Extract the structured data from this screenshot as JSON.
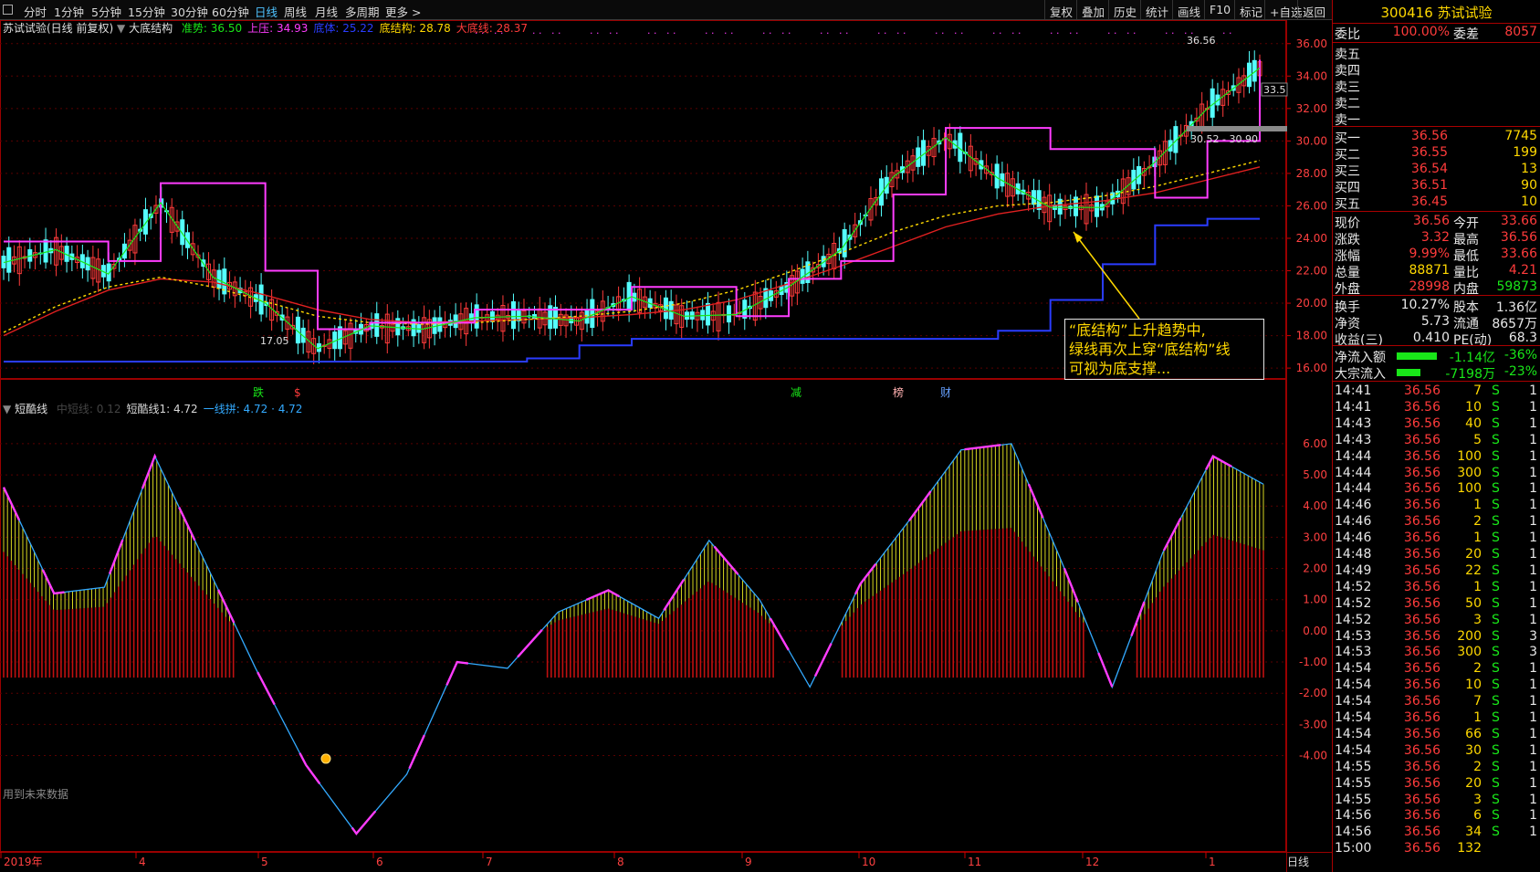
{
  "toolbar": {
    "periods": [
      "分时",
      "1分钟",
      "5分钟",
      "15分钟",
      "30分钟",
      "60分钟",
      "日线",
      "周线",
      "月线",
      "多周期",
      "更多 >"
    ],
    "active_period": "日线",
    "right_buttons": [
      "复权",
      "叠加",
      "历史",
      "统计",
      "画线",
      "F10",
      "标记",
      "+自选",
      "返回"
    ]
  },
  "main_chart": {
    "stock_label": "苏试试验(日线 前复权)",
    "indicator_name": "大底结构",
    "legend": [
      {
        "label": "准势:",
        "value": "36.50",
        "color": "#19e619"
      },
      {
        "label": "上压:",
        "value": "34.93",
        "color": "#ff3cff"
      },
      {
        "label": "底体:",
        "value": "25.22",
        "color": "#2a3cff"
      },
      {
        "label": "底结构:",
        "value": "28.78",
        "color": "#ffd800"
      },
      {
        "label": "大底线:",
        "value": "28.37",
        "color": "#ff3b3b"
      }
    ],
    "price_ticks": [
      "36.00",
      "34.00",
      "32.00",
      "30.00",
      "28.00",
      "26.00",
      "24.00",
      "22.00",
      "20.00",
      "18.00",
      "16.00"
    ],
    "high_label": "36.56",
    "low_label": "17.05",
    "current_tag": "33.5",
    "range_tag": "30.52 - 30.90",
    "events": [
      {
        "text": "跌",
        "color": "#19e619"
      },
      {
        "text": "$",
        "color": "#ff3b3b"
      },
      {
        "text": "减",
        "color": "#19e619"
      },
      {
        "text": "榜",
        "color": "#ffb0b0"
      },
      {
        "text": "财",
        "color": "#66a0ff"
      }
    ],
    "annotation": [
      "“底结构”上升趋势中,",
      "绿线再次上穿“底结构”线",
      "可视为底支撑..."
    ]
  },
  "sub_chart": {
    "indicator_name": "短酷线",
    "legend": [
      {
        "label": "中短线:",
        "value": "0.12",
        "color": "#444444"
      },
      {
        "label": "短酷线1:",
        "value": "4.72",
        "color": "#d8d8d8"
      },
      {
        "label": "一线拼:",
        "value": "4.72 · 4.72",
        "color": "#33aaff"
      }
    ],
    "ticks": [
      "6.00",
      "5.00",
      "4.00",
      "3.00",
      "2.00",
      "1.00",
      "0.00",
      "-1.00",
      "-2.00",
      "-3.00",
      "-4.00"
    ],
    "footnote": "用到未来数据"
  },
  "x_axis": {
    "labels": [
      "2019年",
      "4",
      "5",
      "6",
      "7",
      "8",
      "9",
      "10",
      "11",
      "12",
      "1"
    ],
    "period_tag": "日线"
  },
  "chart_data": {
    "type": "line",
    "title": "",
    "ylim": [
      15.5,
      37.0
    ],
    "series": [
      {
        "name": "大底线",
        "values": [
          18.0,
          19.5,
          20.8,
          21.5,
          21.3,
          20.5,
          19.6,
          19.0,
          18.8,
          18.9,
          19.0,
          19.1,
          19.3,
          19.6,
          20.2,
          21.2,
          22.3,
          23.5,
          24.7,
          25.5,
          26.0,
          26.3,
          26.8,
          27.6,
          28.4
        ]
      },
      {
        "name": "底结构",
        "values": [
          18.2,
          19.8,
          21.0,
          21.6,
          21.0,
          20.1,
          19.2,
          18.8,
          18.7,
          18.8,
          19.0,
          19.2,
          19.5,
          20.0,
          20.8,
          21.9,
          23.1,
          24.4,
          25.4,
          26.0,
          26.2,
          26.6,
          27.2,
          28.0,
          28.8
        ]
      },
      {
        "name": "底体",
        "values": [
          16.4,
          16.4,
          16.4,
          16.4,
          16.4,
          16.4,
          16.4,
          16.4,
          16.4,
          16.4,
          16.6,
          17.4,
          17.8,
          17.8,
          17.8,
          17.8,
          17.8,
          17.8,
          17.8,
          18.3,
          20.2,
          22.4,
          24.8,
          25.2,
          25.2
        ]
      },
      {
        "name": "上压",
        "values": [
          23.8,
          23.8,
          22.6,
          27.4,
          27.4,
          22.0,
          18.4,
          18.8,
          18.8,
          19.6,
          19.6,
          19.6,
          21.0,
          21.0,
          19.2,
          21.5,
          22.6,
          26.7,
          30.8,
          30.8,
          29.5,
          29.5,
          26.5,
          30.0,
          35.0
        ]
      },
      {
        "name": "准势",
        "values": [
          22.5,
          23.3,
          21.8,
          26.2,
          21.6,
          20.0,
          17.2,
          18.6,
          18.4,
          19.1,
          19.2,
          18.9,
          20.4,
          19.2,
          19.3,
          21.0,
          23.3,
          27.8,
          30.2,
          27.7,
          25.9,
          25.9,
          28.7,
          32.0,
          34.5
        ]
      }
    ],
    "x": [
      "2019-03",
      "2019-03",
      "2019-04",
      "2019-04",
      "2019-04",
      "2019-05",
      "2019-05",
      "2019-06",
      "2019-06",
      "2019-07",
      "2019-07",
      "2019-08",
      "2019-08",
      "2019-08",
      "2019-09",
      "2019-09",
      "2019-10",
      "2019-10",
      "2019-11",
      "2019-11",
      "2019-12",
      "2019-12",
      "2020-01",
      "2020-01",
      "2020-01"
    ],
    "osc_series": {
      "name": "短酷线",
      "values": [
        4.6,
        1.2,
        1.4,
        5.6,
        2.2,
        -1.2,
        -4.3,
        -6.5,
        -4.6,
        -1.0,
        -1.2,
        0.6,
        1.3,
        0.4,
        2.9,
        1.0,
        -1.8,
        1.5,
        3.6,
        5.8,
        6.0,
        2.2,
        -1.8,
        2.5,
        5.6,
        4.7
      ]
    },
    "osc_ylim": [
      -7.0,
      6.7
    ]
  },
  "side_panel": {
    "title": "300416 苏试试验",
    "webi": {
      "label": "委比",
      "value": "100.00%",
      "label2": "委差",
      "value2": "8057"
    },
    "sell": [
      "卖五",
      "卖四",
      "卖三",
      "卖二",
      "卖一"
    ],
    "buy": [
      {
        "label": "买一",
        "price": "36.56",
        "vol": "7745"
      },
      {
        "label": "买二",
        "price": "36.55",
        "vol": "199"
      },
      {
        "label": "买三",
        "price": "36.54",
        "vol": "13"
      },
      {
        "label": "买四",
        "price": "36.51",
        "vol": "90"
      },
      {
        "label": "买五",
        "price": "36.45",
        "vol": "10"
      }
    ],
    "quote": [
      {
        "l1": "现价",
        "v1": "36.56",
        "c1": "r",
        "l2": "今开",
        "v2": "33.66",
        "c2": "r"
      },
      {
        "l1": "涨跌",
        "v1": "3.32",
        "c1": "r",
        "l2": "最高",
        "v2": "36.56",
        "c2": "r"
      },
      {
        "l1": "涨幅",
        "v1": "9.99%",
        "c1": "r",
        "l2": "最低",
        "v2": "33.66",
        "c2": "r"
      },
      {
        "l1": "总量",
        "v1": "88871",
        "c1": "y",
        "l2": "量比",
        "v2": "4.21",
        "c2": "r"
      },
      {
        "l1": "外盘",
        "v1": "28998",
        "c1": "r",
        "l2": "内盘",
        "v2": "59873",
        "c2": "g"
      }
    ],
    "fund": [
      {
        "l1": "换手",
        "v1": "10.27%",
        "l2": "股本",
        "v2": "1.36亿"
      },
      {
        "l1": "净资",
        "v1": "5.73",
        "l2": "流通",
        "v2": "8657万"
      },
      {
        "l1": "收益(三)",
        "v1": "0.410",
        "l2": "PE(动)",
        "v2": "68.3"
      }
    ],
    "flow": [
      {
        "label": "净流入额",
        "value": "-1.14亿",
        "pct": "-36%"
      },
      {
        "label": "大宗流入",
        "value": "-7198万",
        "pct": "-23%"
      }
    ],
    "ticks": [
      [
        "14:41",
        "36.56",
        "7",
        "S",
        "1"
      ],
      [
        "14:41",
        "36.56",
        "10",
        "S",
        "1"
      ],
      [
        "14:43",
        "36.56",
        "40",
        "S",
        "1"
      ],
      [
        "14:43",
        "36.56",
        "5",
        "S",
        "1"
      ],
      [
        "14:44",
        "36.56",
        "100",
        "S",
        "1"
      ],
      [
        "14:44",
        "36.56",
        "300",
        "S",
        "1"
      ],
      [
        "14:44",
        "36.56",
        "100",
        "S",
        "1"
      ],
      [
        "14:46",
        "36.56",
        "1",
        "S",
        "1"
      ],
      [
        "14:46",
        "36.56",
        "2",
        "S",
        "1"
      ],
      [
        "14:46",
        "36.56",
        "1",
        "S",
        "1"
      ],
      [
        "14:48",
        "36.56",
        "20",
        "S",
        "1"
      ],
      [
        "14:49",
        "36.56",
        "22",
        "S",
        "1"
      ],
      [
        "14:52",
        "36.56",
        "1",
        "S",
        "1"
      ],
      [
        "14:52",
        "36.56",
        "50",
        "S",
        "1"
      ],
      [
        "14:52",
        "36.56",
        "3",
        "S",
        "1"
      ],
      [
        "14:53",
        "36.56",
        "200",
        "S",
        "3"
      ],
      [
        "14:53",
        "36.56",
        "300",
        "S",
        "3"
      ],
      [
        "14:54",
        "36.56",
        "2",
        "S",
        "1"
      ],
      [
        "14:54",
        "36.56",
        "10",
        "S",
        "1"
      ],
      [
        "14:54",
        "36.56",
        "7",
        "S",
        "1"
      ],
      [
        "14:54",
        "36.56",
        "1",
        "S",
        "1"
      ],
      [
        "14:54",
        "36.56",
        "66",
        "S",
        "1"
      ],
      [
        "14:54",
        "36.56",
        "30",
        "S",
        "1"
      ],
      [
        "14:55",
        "36.56",
        "2",
        "S",
        "1"
      ],
      [
        "14:55",
        "36.56",
        "20",
        "S",
        "1"
      ],
      [
        "14:55",
        "36.56",
        "3",
        "S",
        "1"
      ],
      [
        "14:56",
        "36.56",
        "6",
        "S",
        "1"
      ],
      [
        "14:56",
        "36.56",
        "34",
        "S",
        "1"
      ],
      [
        "15:00",
        "36.56",
        "132",
        "",
        ""
      ]
    ]
  }
}
